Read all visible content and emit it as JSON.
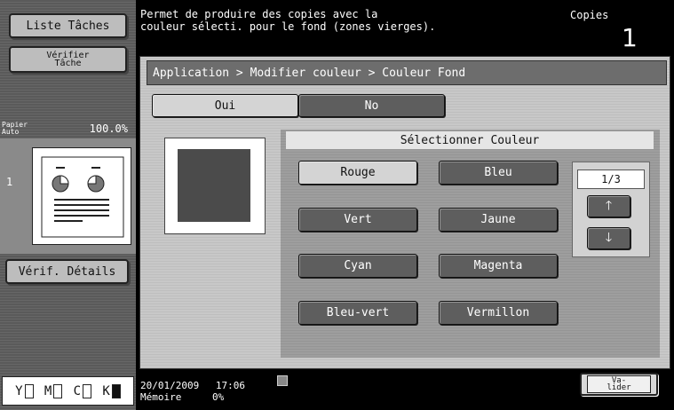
{
  "sidebar": {
    "liste_taches": "Liste Tâches",
    "verifier_tache_line1": "Vérifier",
    "verifier_tache_line2": "Tâche",
    "papier_line1": "Papier",
    "papier_line2": "Auto",
    "zoom": "100.0%",
    "page_number": "1",
    "verif_details": "Vérif. Détails",
    "toner_labels": [
      "Y",
      "M",
      "C",
      "K"
    ]
  },
  "header": {
    "message_line1": "Permet de produire des copies avec la",
    "message_line2": "couleur sélecti. pour le fond (zones vierges).",
    "mode": "Copies",
    "copy_count": "1"
  },
  "breadcrumb": "Application > Modifier couleur > Couleur Fond",
  "toggle": {
    "oui": "Oui",
    "no": "No"
  },
  "color_panel": {
    "title": "Sélectionner Couleur",
    "colors": [
      "Rouge",
      "Bleu",
      "Vert",
      "Jaune",
      "Cyan",
      "Magenta",
      "Bleu-vert",
      "Vermillon"
    ],
    "page_indicator": "1/3",
    "preview_color": "#4b4b4b"
  },
  "footer": {
    "date": "20/01/2009",
    "time": "17:06",
    "memoire_label": "Mémoire",
    "memoire_value": "0%",
    "valider_line1": "Va-",
    "valider_line2": "lider"
  }
}
